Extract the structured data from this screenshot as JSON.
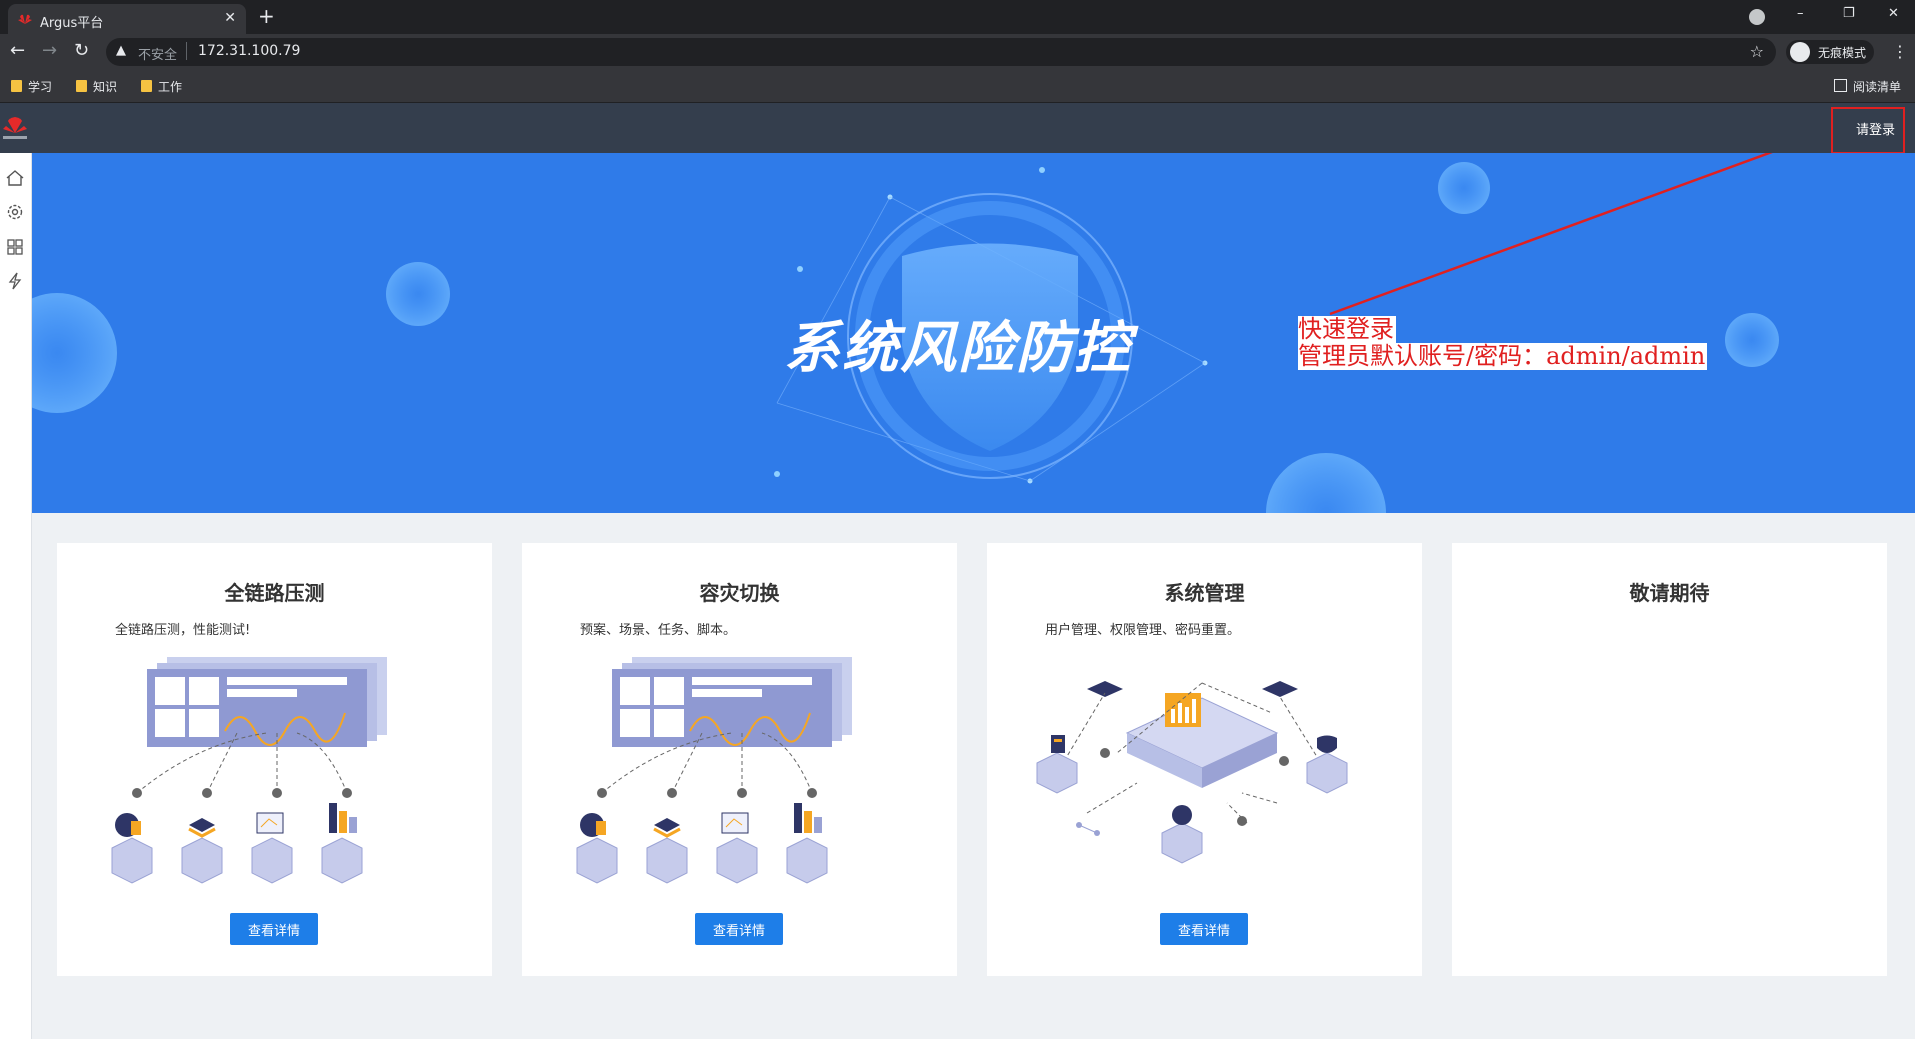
{
  "browser": {
    "tab_title": "Argus平台",
    "tab_close": "✕",
    "new_tab": "+",
    "window_controls": {
      "minimize": "–",
      "restore": "❐",
      "close": "✕"
    },
    "nav": {
      "back": "←",
      "forward": "→",
      "reload": "↻"
    },
    "address_bar": {
      "warning_icon": "▲",
      "security_label": "不安全",
      "url": "172.31.100.79",
      "star": "☆"
    },
    "incognito_label": "无痕模式",
    "menu": "⋮",
    "bookmarks": [
      {
        "label": "学习"
      },
      {
        "label": "知识"
      },
      {
        "label": "工作"
      }
    ],
    "reading_list": "阅读清单"
  },
  "header": {
    "logo_alt": "HUAWEI",
    "login_label": "请登录"
  },
  "sidebar": {
    "items": [
      {
        "icon": "home-icon"
      },
      {
        "icon": "gear-icon"
      },
      {
        "icon": "grid-icon"
      },
      {
        "icon": "lightning-icon"
      }
    ]
  },
  "banner": {
    "title": "系统风险防控"
  },
  "annotation": {
    "line1": "快速登录",
    "line2": "管理员默认账号/密码：admin/admin",
    "color": "#e02020"
  },
  "cards": [
    {
      "title": "全链路压测",
      "desc": "全链路压测，性能测试!",
      "button": "查看详情"
    },
    {
      "title": "容灾切换",
      "desc": "预案、场景、任务、脚本。",
      "button": "查看详情"
    },
    {
      "title": "系统管理",
      "desc": "用户管理、权限管理、密码重置。",
      "button": "查看详情"
    },
    {
      "title": "敬请期待",
      "desc": ""
    }
  ],
  "colors": {
    "banner": "#2f7be9",
    "header": "#343e4d",
    "button": "#1e7ee8",
    "accent_orange": "#f5a623"
  }
}
